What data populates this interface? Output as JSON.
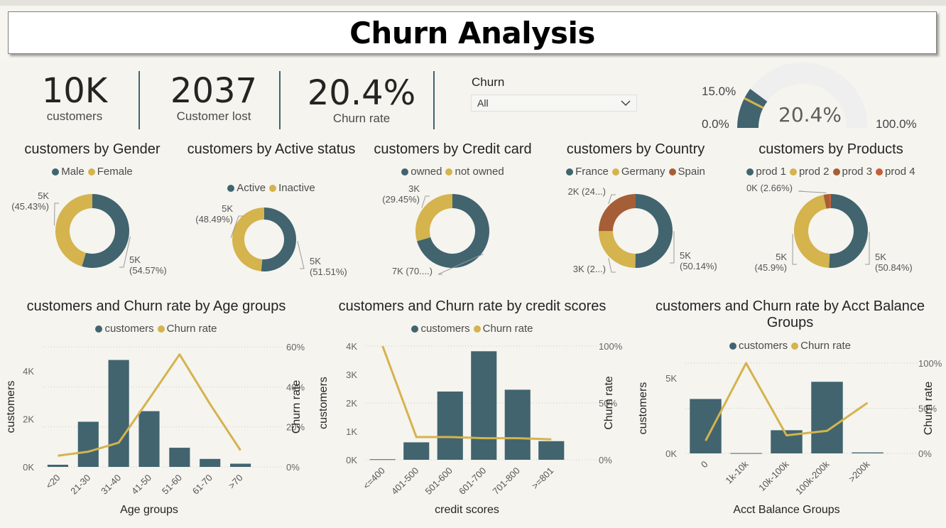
{
  "title": "Churn Analysis",
  "kpis": [
    {
      "value": "10K",
      "label": "customers"
    },
    {
      "value": "2037",
      "label": "Customer lost"
    },
    {
      "value": "20.4%",
      "label": "Churn rate"
    }
  ],
  "slicer": {
    "title": "Churn",
    "value": "All"
  },
  "gauge": {
    "value": 0.204,
    "value_label": "20.4%",
    "min_label": "0.0%",
    "max_label": "100.0%",
    "target_label": "15.0%",
    "target": 0.15
  },
  "colors": {
    "teal": "#41646f",
    "gold": "#d5b34d",
    "brown": "#a65e36",
    "red": "#c95d3a"
  },
  "chart_data": [
    {
      "type": "pie",
      "title": "customers by Gender",
      "legend": [
        "Male",
        "Female"
      ],
      "values": [
        5457,
        4543
      ],
      "labels": [
        {
          "l1": "5K",
          "l2": "(54.57%)"
        },
        {
          "l1": "5K",
          "l2": "(45.43%)"
        }
      ]
    },
    {
      "type": "pie",
      "title": "customers by Active status",
      "legend": [
        "Active",
        "Inactive"
      ],
      "values": [
        5151,
        4849
      ],
      "labels": [
        {
          "l1": "5K",
          "l2": "(51.51%)"
        },
        {
          "l1": "5K",
          "l2": "(48.49%)"
        }
      ]
    },
    {
      "type": "pie",
      "title": "customers by Credit card",
      "legend": [
        "owned",
        "not owned"
      ],
      "values": [
        7055,
        2945
      ],
      "labels": [
        {
          "l1": "7K (70....)",
          "l2": ""
        },
        {
          "l1": "3K",
          "l2": "(29.45%)"
        }
      ]
    },
    {
      "type": "pie",
      "title": "customers by Country",
      "legend": [
        "France",
        "Germany",
        "Spain"
      ],
      "values": [
        5014,
        2477,
        2509
      ],
      "labels": [
        {
          "l1": "5K",
          "l2": "(50.14%)"
        },
        {
          "l1": "3K (2...)",
          "l2": ""
        },
        {
          "l1": "2K (24...)",
          "l2": ""
        }
      ]
    },
    {
      "type": "pie",
      "title": "customers by Products",
      "legend": [
        "prod 1",
        "prod 2",
        "prod 3",
        "prod 4"
      ],
      "values": [
        5084,
        4590,
        266,
        60
      ],
      "labels": [
        {
          "l1": "5K",
          "l2": "(50.84%)"
        },
        {
          "l1": "5K",
          "l2": "(45.9%)"
        },
        {
          "l1": "0K (2.66%)",
          "l2": ""
        },
        {
          "l1": "",
          "l2": ""
        }
      ]
    },
    {
      "type": "bar",
      "title": "customers and Churn rate by Age groups",
      "xlabel": "Age groups",
      "ylabel": "customers",
      "y2label": "Churn rate",
      "legend": [
        "customers",
        "Churn rate"
      ],
      "categories": [
        "<20",
        "21-30",
        "31-40",
        "41-50",
        "51-60",
        "61-70",
        ">70"
      ],
      "values": [
        89,
        1879,
        4451,
        2320,
        797,
        331,
        133
      ],
      "line": [
        0.056,
        0.076,
        0.121,
        0.34,
        0.562,
        0.314,
        0.083
      ],
      "ylim": [
        0,
        5000
      ],
      "yticks": [
        0,
        2000,
        4000
      ],
      "yticklabels": [
        "0K",
        "2K",
        "4K"
      ],
      "y2lim": [
        0,
        0.6
      ],
      "y2ticks": [
        0,
        0.2,
        0.4,
        0.6
      ],
      "y2ticklabels": [
        "0%",
        "20%",
        "40%",
        "60%"
      ]
    },
    {
      "type": "bar",
      "title": "customers and Churn rate by credit scores",
      "xlabel": "credit scores",
      "ylabel": "customers",
      "y2label": "Churn rate",
      "legend": [
        "customers",
        "Churn rate"
      ],
      "categories": [
        "<=400",
        "401-500",
        "501-600",
        "601-700",
        "701-800",
        ">=801"
      ],
      "values": [
        19,
        614,
        2401,
        3818,
        2465,
        655
      ],
      "line": [
        1.0,
        0.2,
        0.2,
        0.19,
        0.19,
        0.18
      ],
      "ylim": [
        0,
        4000
      ],
      "yticks": [
        0,
        1000,
        2000,
        3000,
        4000
      ],
      "yticklabels": [
        "0K",
        "1K",
        "2K",
        "3K",
        "4K"
      ],
      "y2lim": [
        0,
        1.0
      ],
      "y2ticks": [
        0,
        0.5,
        1.0
      ],
      "y2ticklabels": [
        "0%",
        "50%",
        "100%"
      ]
    },
    {
      "type": "bar",
      "title": "customers and Churn rate by Acct Balance Groups",
      "xlabel": "Acct Balance Groups",
      "ylabel": "customers",
      "y2label": "Churn rate",
      "legend": [
        "customers",
        "Churn rate"
      ],
      "categories": [
        "0",
        "1k-10k",
        "10k-100k",
        "100k-200k",
        ">200k"
      ],
      "values": [
        3617,
        20,
        1540,
        4760,
        63
      ],
      "line": [
        0.14,
        1.0,
        0.2,
        0.25,
        0.56
      ],
      "ylim": [
        0,
        6000
      ],
      "yticks": [
        0,
        5000
      ],
      "yticklabels": [
        "0K",
        "5K"
      ],
      "y2lim": [
        0,
        1.0
      ],
      "y2ticks": [
        0,
        0.5,
        1.0
      ],
      "y2ticklabels": [
        "0%",
        "50%",
        "100%"
      ]
    }
  ]
}
